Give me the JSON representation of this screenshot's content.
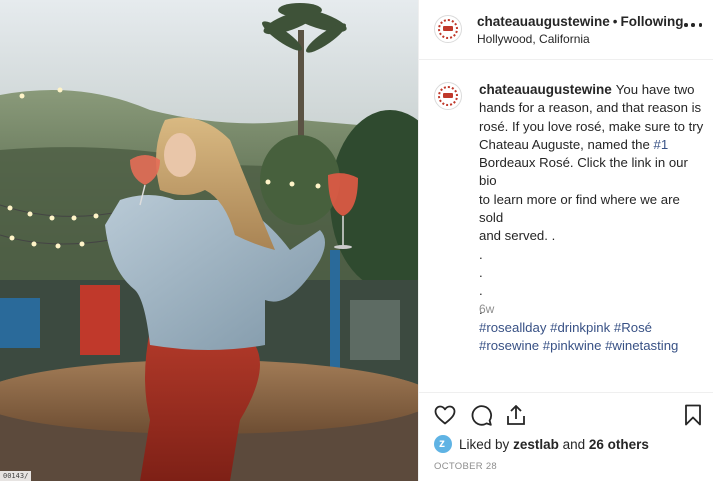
{
  "photo": {
    "alt": "",
    "corner_label": "00143/"
  },
  "post": {
    "username": "chateauaugustewine",
    "separator": "•",
    "follow_state": "Following",
    "location": "Hollywood, California",
    "more_icon": "more-horizontal-icon",
    "caption_lines": [
      "You have two",
      "hands for a reason, and that reason is",
      "rosé. If you love rosé, make sure to try",
      "Chateau Auguste, named the ",
      "Bordeaux Rosé. Click the link in our bio",
      "to learn more or find where we are sold",
      "and served. .",
      ".",
      ".",
      ".",
      "."
    ],
    "caption_mention": "#1",
    "hashtags_line1": "#roseallday #drinkpink #Rosé",
    "hashtags_line2": "#rosewine #pinkwine #winetasting",
    "age": "6w",
    "likes_prefix": "Liked by",
    "liked_by": "zestlab",
    "likes_and": "and",
    "likes_others": "26 others",
    "date": "OCTOBER 28",
    "icons": {
      "like": "heart-icon",
      "comment": "comment-bubble-icon",
      "share": "share-icon",
      "save": "bookmark-icon"
    },
    "colors": {
      "link": "#385185",
      "muted": "#8e8e8e",
      "text": "#262626"
    }
  }
}
